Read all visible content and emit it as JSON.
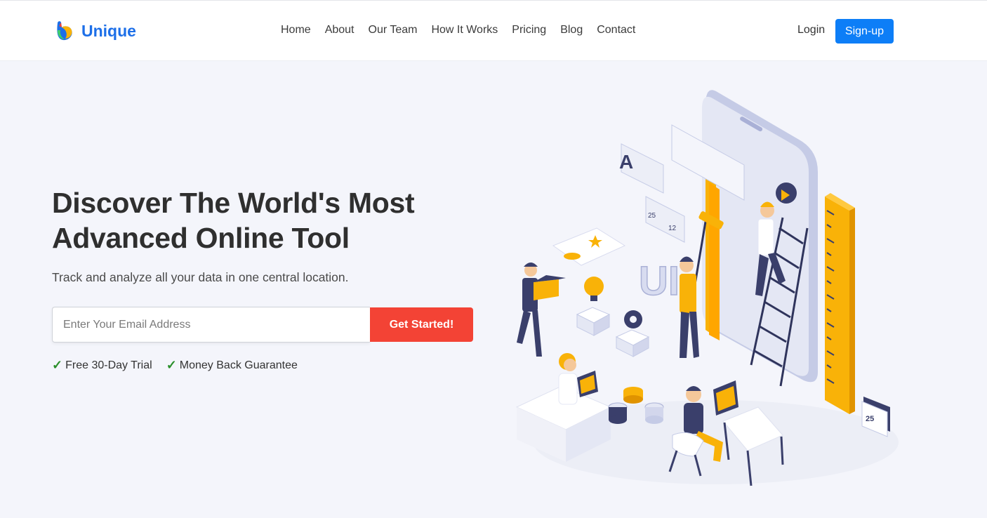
{
  "brand": {
    "name": "Unique",
    "logo_icon": "unique-logo-icon"
  },
  "nav": {
    "links": [
      "Home",
      "About",
      "Our Team",
      "How It Works",
      "Pricing",
      "Blog",
      "Contact"
    ],
    "login": "Login",
    "signup": "Sign-up"
  },
  "hero": {
    "title": "Discover The World's Most Advanced Online Tool",
    "subtitle": "Track and analyze all your data in one central location.",
    "email_placeholder": "Enter Your Email Address",
    "cta": "Get Started!",
    "features": [
      "Free 30-Day Trial",
      "Money Back Guarantee"
    ],
    "check_mark": "✓"
  },
  "illustration": {
    "ui_letters": "UI",
    "letter_a": "A",
    "likes": "25",
    "comments": "12",
    "calendar_day": "25"
  },
  "colors": {
    "brand": "#1d6fe8",
    "signup_button": "#0d7ef7",
    "cta_button": "#f34335",
    "check": "#2a8f2a",
    "accent_yellow": "#f9b208",
    "background": "#f4f5fb"
  }
}
